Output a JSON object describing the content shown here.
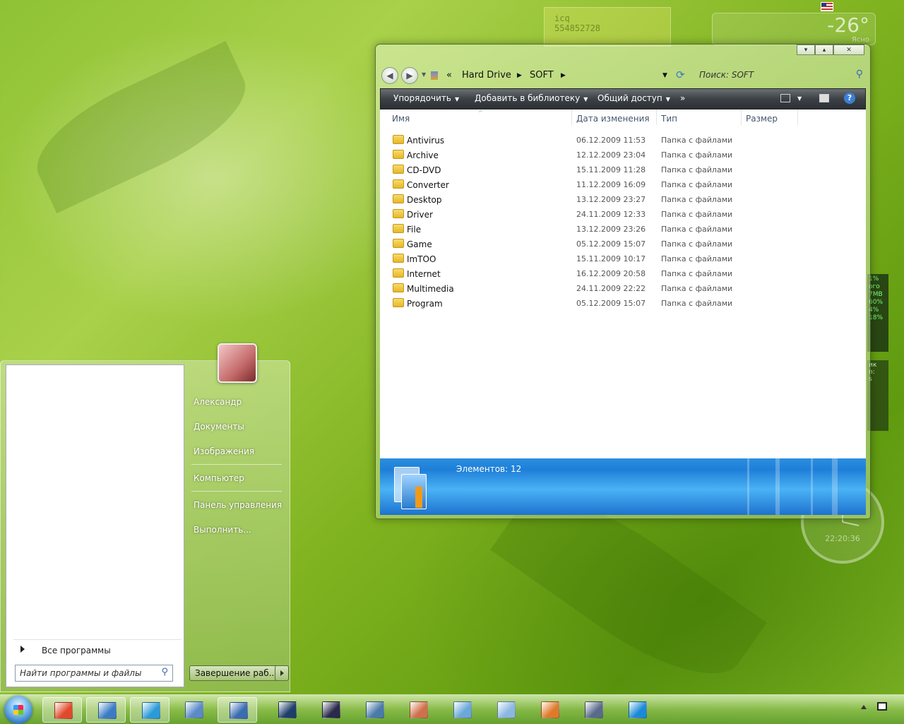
{
  "desktop": {
    "icq_gadget": {
      "title": "icq",
      "number": "554852728"
    },
    "weather_gadget": {
      "temperature": "-26°",
      "condition": "Ясно"
    },
    "cpu_gadget": {
      "lines": [
        "1%",
        "ого",
        "7MB",
        "60%",
        "4%",
        "18%"
      ]
    },
    "net_gadget": {
      "lines": [
        "ик",
        "n:",
        "s"
      ]
    },
    "clock_gadget": {
      "time": "22:20:36"
    }
  },
  "explorer": {
    "breadcrumb": [
      "Hard Drive",
      "SOFT"
    ],
    "breadcrumb_prefix": "«",
    "search_placeholder": "Поиск: SOFT",
    "toolbar": {
      "organize": "Упорядочить",
      "add_to_library": "Добавить в библиотеку",
      "share": "Общий доступ",
      "more": "»",
      "help": "?"
    },
    "columns": {
      "name": "Имя",
      "date": "Дата изменения",
      "type": "Тип",
      "size": "Размер"
    },
    "files": [
      {
        "name": "Antivirus",
        "date": "06.12.2009 11:53",
        "type": "Папка с файлами"
      },
      {
        "name": "Archive",
        "date": "12.12.2009 23:04",
        "type": "Папка с файлами"
      },
      {
        "name": "CD-DVD",
        "date": "15.11.2009 11:28",
        "type": "Папка с файлами"
      },
      {
        "name": "Converter",
        "date": "11.12.2009 16:09",
        "type": "Папка с файлами"
      },
      {
        "name": "Desktop",
        "date": "13.12.2009 23:27",
        "type": "Папка с файлами"
      },
      {
        "name": "Driver",
        "date": "24.11.2009 12:33",
        "type": "Папка с файлами"
      },
      {
        "name": "File",
        "date": "13.12.2009 23:26",
        "type": "Папка с файлами"
      },
      {
        "name": "Game",
        "date": "05.12.2009 15:07",
        "type": "Папка с файлами"
      },
      {
        "name": "ImTOO",
        "date": "15.11.2009 10:17",
        "type": "Папка с файлами"
      },
      {
        "name": "Internet",
        "date": "16.12.2009 20:58",
        "type": "Папка с файлами"
      },
      {
        "name": "Multimedia",
        "date": "24.11.2009 22:22",
        "type": "Папка с файлами"
      },
      {
        "name": "Program",
        "date": "05.12.2009 15:07",
        "type": "Папка с файлами"
      }
    ],
    "status": "Элементов: 12"
  },
  "start_menu": {
    "user_links": [
      "Александр",
      "Документы",
      "Изображения",
      "Компьютер",
      "Панель управления",
      "Выполнить..."
    ],
    "all_programs": "Все программы",
    "search_placeholder": "Найти программы и файлы",
    "shutdown": "Завершение раб..."
  },
  "taskbar": {
    "buttons": [
      {
        "name": "taskbar-app-1",
        "color": "#e04a2a",
        "active": true
      },
      {
        "name": "taskbar-app-2",
        "color": "#3a7cc4",
        "active": true
      },
      {
        "name": "taskbar-app-3",
        "color": "#2a9ad8",
        "active": true
      },
      {
        "name": "taskbar-app-4",
        "color": "#5a8ac8",
        "active": false
      },
      {
        "name": "taskbar-app-5",
        "color": "#3a6cb0",
        "active": true
      },
      {
        "name": "taskbar-app-6",
        "color": "#1e3e6a",
        "active": false
      },
      {
        "name": "taskbar-app-7",
        "color": "#2a2a4a",
        "active": false
      },
      {
        "name": "taskbar-app-8",
        "color": "#4a7aa8",
        "active": false
      },
      {
        "name": "taskbar-app-9",
        "color": "#d0704a",
        "active": false
      },
      {
        "name": "taskbar-app-10",
        "color": "#6aa8d8",
        "active": false
      },
      {
        "name": "taskbar-app-11",
        "color": "#8ab8e0",
        "active": false
      },
      {
        "name": "taskbar-app-12",
        "color": "#e07a2a",
        "active": false
      },
      {
        "name": "taskbar-app-13",
        "color": "#5a6a8a",
        "active": false
      },
      {
        "name": "taskbar-app-14",
        "color": "#1a8ad8",
        "active": false
      }
    ]
  }
}
